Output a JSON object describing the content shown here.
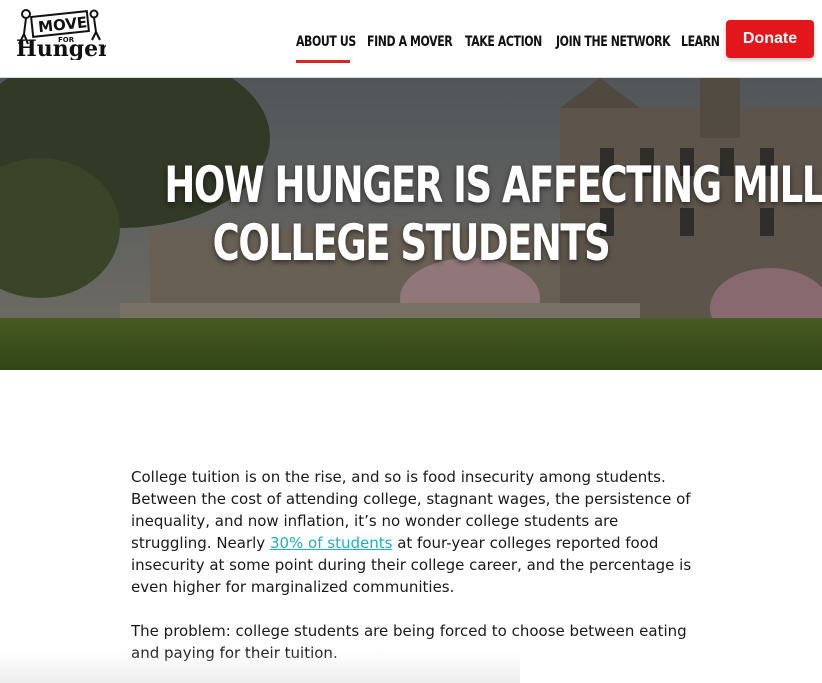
{
  "header": {
    "logo": {
      "line1": "MOVE",
      "line2": "FOR",
      "line3": "Hunger"
    },
    "nav": [
      {
        "label": "ABOUT US",
        "active": true
      },
      {
        "label": "FIND A MOVER",
        "active": false
      },
      {
        "label": "TAKE ACTION",
        "active": false
      },
      {
        "label": "JOIN THE NETWORK",
        "active": false
      },
      {
        "label": "LEARN",
        "active": false
      }
    ],
    "donate_label": "Donate",
    "accent_color": "#e3161b"
  },
  "hero": {
    "title_line1": "HOW HUNGER IS AFFECTING MILLIONS OF",
    "title_line2": "COLLEGE STUDENTS",
    "image": "college-campus-photo"
  },
  "article": {
    "p1_before_link": "College tuition is on the rise, and so is food insecurity among students. Between the cost of attending college, stagnant wages, the persistence of inequality, and now inflation, it’s no wonder college students are struggling. Nearly ",
    "p1_link": "30% of students",
    "p1_after_link": " at four-year colleges reported food insecurity at some point during their college career, and the percentage is even higher for marginalized communities.",
    "p2": "The problem: college students are being forced to choose between eating and paying for their tuition.",
    "link_color": "#1bb3b8"
  }
}
